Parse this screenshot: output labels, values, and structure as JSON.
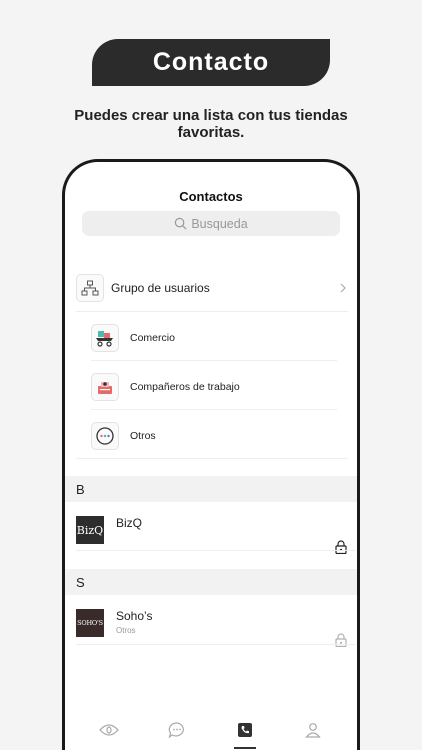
{
  "banner": {
    "title": "Contacto"
  },
  "subtitle": "Puedes crear una lista con tus tiendas favoritas.",
  "screen": {
    "title": "Contactos",
    "search_placeholder": "Busqueda"
  },
  "groups": {
    "header_label": "Grupo de usuarios",
    "items": [
      {
        "label": "Comercio",
        "icon": "shop-cart-icon"
      },
      {
        "label": "Compañeros de trabajo",
        "icon": "coworkers-icon"
      },
      {
        "label": "Otros",
        "icon": "more-icon"
      }
    ]
  },
  "index_letters": [
    "B",
    "S"
  ],
  "sections": [
    {
      "letter": "B",
      "contacts": [
        {
          "name": "BizQ",
          "logo": "BizQ",
          "sub": ""
        }
      ]
    },
    {
      "letter": "S",
      "contacts": [
        {
          "name": "Soho’s",
          "logo": "SOHO'S",
          "sub": "Otros"
        }
      ]
    }
  ],
  "tabs": [
    {
      "name": "eye-tab-icon",
      "active": false
    },
    {
      "name": "chat-tab-icon",
      "active": false
    },
    {
      "name": "contacts-tab-icon",
      "active": true
    },
    {
      "name": "profile-tab-icon",
      "active": false
    }
  ]
}
